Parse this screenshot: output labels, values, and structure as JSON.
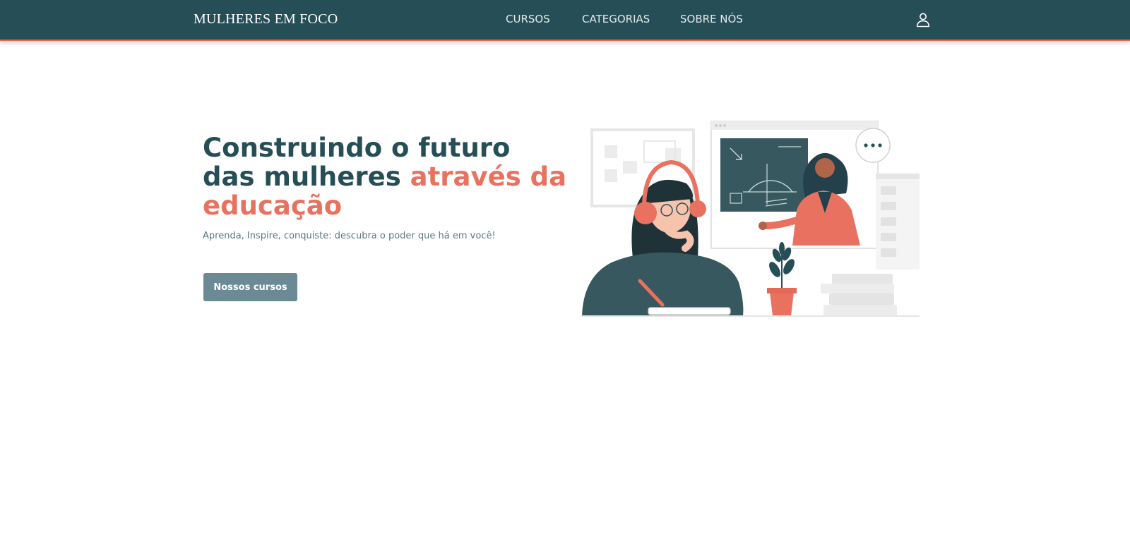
{
  "brand": "MULHERES EM FOCO",
  "nav": {
    "cursos": "CURSOS",
    "categorias": "CATEGORIAS",
    "sobre": "SOBRE NÓS"
  },
  "hero": {
    "title_part1": "Construindo o futuro das mulheres ",
    "title_accent": "através da educação",
    "subtitle": "Aprenda, Inspire, conquiste: descubra o poder que há em você!",
    "cta_label": "Nossos cursos"
  },
  "icons": {
    "user": "user-icon",
    "illustration": "online-learning-illustration"
  },
  "colors": {
    "navbar": "#264e57",
    "accent": "#e8725f",
    "button": "#6c8a95",
    "title": "#264e57"
  }
}
